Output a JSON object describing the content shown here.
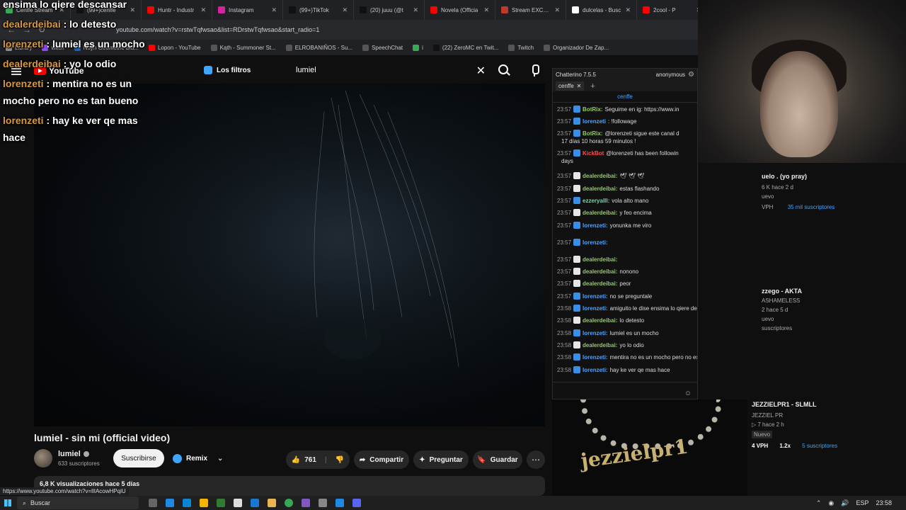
{
  "browser": {
    "tabs": [
      {
        "label": "Cenffe Stream",
        "color": "#3aa757"
      },
      {
        "label": "(99+)cenffe",
        "color": "#111111"
      },
      {
        "label": "Huntr - Industr",
        "color": "#ff0000"
      },
      {
        "label": "Instagram",
        "color": "#d6249f"
      },
      {
        "label": "(99+)TikTok",
        "color": "#111111"
      },
      {
        "label": "(20) juuu (@t",
        "color": "#111111"
      },
      {
        "label": "Novela (Officia",
        "color": "#ff0000"
      },
      {
        "label": "Stream EXCALI",
        "color": "#c0392b"
      },
      {
        "label": "dulcelas - Busc",
        "color": "#ffffff"
      },
      {
        "label": "2cool - P",
        "color": "#ff0000"
      }
    ],
    "url": "youtube.com/watch?v=rstwTqfwsao&list=RDrstwTqfwsao&start_radio=1",
    "bookmarks": [
      {
        "label": "Library",
        "color": "#8e8e8e"
      },
      {
        "label": "witch",
        "color": "#9146ff"
      },
      {
        "label": "Noyh Geometric Bla...",
        "color": "#1565c0"
      },
      {
        "label": "Lopon - YouTube",
        "color": "#ff0000"
      },
      {
        "label": "Kąth - Summoner St...",
        "color": "#555555"
      },
      {
        "label": "ELROBANIÑOS - Su...",
        "color": "#555555"
      },
      {
        "label": "SpeechChat",
        "color": "#555555"
      },
      {
        "label": "i",
        "color": "#3aa757"
      },
      {
        "label": "(22) ZeroMC en Twit...",
        "color": "#111111"
      },
      {
        "label": "Twitch",
        "color": "#555555"
      },
      {
        "label": "Organizador De Zap...",
        "color": "#555555"
      }
    ]
  },
  "youtube": {
    "logo": "YouTube",
    "filters_label": "Los filtros",
    "search_value": "lumiel",
    "video_title": "lumiel - sin mi (official video)",
    "channel_name": "lumiel",
    "subscribers": "633 suscriptores",
    "subscribe_label": "Suscribirse",
    "remix_label": "Remix",
    "like_count": "761",
    "share_label": "Compartir",
    "ask_label": "Preguntar",
    "save_label": "Guardar",
    "views_line": "6,8 K visualizaciones  hace 5 días",
    "status_url": "https://www.youtube.com/watch?v=llIAcowHPqiU"
  },
  "overlay": [
    {
      "name": "",
      "text": "ensima lo qiere descansar"
    },
    {
      "name": "dealerdeibai",
      "text": ": lo detesto"
    },
    {
      "name": "lorenzeti",
      "text": ": lumiel es un mocho"
    },
    {
      "name": "dealerdeibai",
      "text": ": yo lo odio"
    },
    {
      "name": "lorenzeti",
      "text": ": mentira no es un"
    },
    {
      "name": "",
      "text": "mocho pero no es tan bueno"
    },
    {
      "name": "lorenzeti",
      "text": ": hay ke ver qe mas"
    },
    {
      "name": "",
      "text": "hace"
    }
  ],
  "chatterino": {
    "title": "Chatterino 7.5.5",
    "user": "anonymous",
    "tab": "cenffe",
    "channel": "cenffe",
    "messages": [
      {
        "time": "23:57",
        "name": "BotRix:",
        "name_color": "#8fd14f",
        "text": "Seguime en ig: https://www.in"
      },
      {
        "time": "23:57",
        "name": "lorenzeti",
        "name_color": "#4da3ff",
        "text": ": !followage"
      },
      {
        "time": "23:57",
        "name": "BotRix:",
        "name_color": "#8fd14f",
        "text": "@lorenzeti sigue este canal d"
      },
      {
        "time": "",
        "name": "",
        "name_color": "#dddddd",
        "text": "17 días 10 horas 59 minutos !"
      },
      {
        "time": "23:57",
        "name": "KickBot",
        "name_color": "#ff4d4d",
        "text": "@lorenzeti has been followin"
      },
      {
        "time": "",
        "name": "",
        "name_color": "#dddddd",
        "text": "days"
      },
      {
        "time": "23:57",
        "name": "dealerdeibai:",
        "name_color": "#9ac27a",
        "text": "🕊 🕊 🕊"
      },
      {
        "time": "23:57",
        "name": "dealerdeibai:",
        "name_color": "#9ac27a",
        "text": "estas flashando"
      },
      {
        "time": "23:57",
        "name": "ezzeryalll:",
        "name_color": "#7ad0a8",
        "text": "vola alto mano"
      },
      {
        "time": "23:57",
        "name": "dealerdeibai:",
        "name_color": "#9ac27a",
        "text": "y feo encima"
      },
      {
        "time": "23:57",
        "name": "lorenzeti:",
        "name_color": "#4da3ff",
        "text": "yonunka me viro"
      },
      {
        "time": "23:57",
        "name": "lorenzeti:",
        "name_color": "#4da3ff",
        "text": ""
      },
      {
        "time": "23:57",
        "name": "dealerdeibai:",
        "name_color": "#9ac27a",
        "text": ""
      },
      {
        "time": "23:57",
        "name": "dealerdeibai:",
        "name_color": "#9ac27a",
        "text": "nonono"
      },
      {
        "time": "23:57",
        "name": "dealerdeibai:",
        "name_color": "#9ac27a",
        "text": "peor"
      },
      {
        "time": "23:57",
        "name": "lorenzeti:",
        "name_color": "#4da3ff",
        "text": "no se preguntale"
      },
      {
        "time": "23:58",
        "name": "lorenzeti:",
        "name_color": "#4da3ff",
        "text": "amiguito le dise ensima lo qiere descansar"
      },
      {
        "time": "23:58",
        "name": "dealerdeibai:",
        "name_color": "#9ac27a",
        "text": "lo detesto"
      },
      {
        "time": "23:58",
        "name": "lorenzeti:",
        "name_color": "#4da3ff",
        "text": "lumiel es un mocho"
      },
      {
        "time": "23:58",
        "name": "dealerdeibai:",
        "name_color": "#9ac27a",
        "text": "yo lo odio"
      },
      {
        "time": "23:58",
        "name": "lorenzeti:",
        "name_color": "#4da3ff",
        "text": "mentira no es un mocho pero no es tan bueno"
      },
      {
        "time": "23:58",
        "name": "lorenzeti:",
        "name_color": "#4da3ff",
        "text": "hay ke ver qe mas hace"
      }
    ]
  },
  "recommendations": [
    {
      "title": "uelo .     (yo   pray)",
      "meta": "6 K  hace 2 d",
      "badge": "uevo",
      "stats": "VPH",
      "subs": "35 mil suscriptores"
    },
    {
      "title": "zzego - AKTA",
      "meta": "ASHAMELESS",
      "meta2": "2  hace 5 d",
      "badge": "uevo",
      "subs": "suscriptores"
    },
    {
      "title": "JEZZIELPR1 - SLMLL",
      "meta": "JEZZIEL PR",
      "meta2": "▷ 7  hace 2 h",
      "badge": "Nuevo",
      "stats": "4 VPH",
      "mult": "1.2x",
      "subs": "5 suscriptores"
    }
  ],
  "thumbnail_text": "jezzielpr1",
  "taskbar": {
    "search": "Buscar",
    "lang": "ESP",
    "time": "23:58"
  }
}
